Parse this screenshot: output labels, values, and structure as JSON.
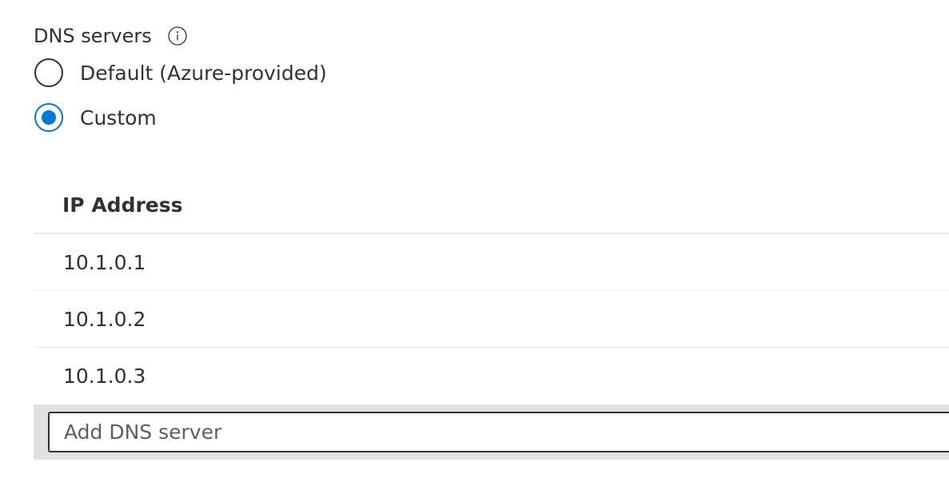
{
  "dns": {
    "label": "DNS servers",
    "info_icon": "info-icon",
    "options": [
      {
        "label": "Default (Azure-provided)",
        "checked": false
      },
      {
        "label": "Custom",
        "checked": true
      }
    ]
  },
  "grid": {
    "header": "IP Address",
    "rows": [
      "10.1.0.1",
      "10.1.0.2",
      "10.1.0.3"
    ]
  },
  "add_input": {
    "placeholder": "Add DNS server",
    "value": ""
  },
  "colors": {
    "accent": "#0078d4",
    "text": "#323130",
    "placeholder": "#605e5c",
    "row_divider": "#edebe9",
    "add_row_background": "#e1e1e1"
  }
}
